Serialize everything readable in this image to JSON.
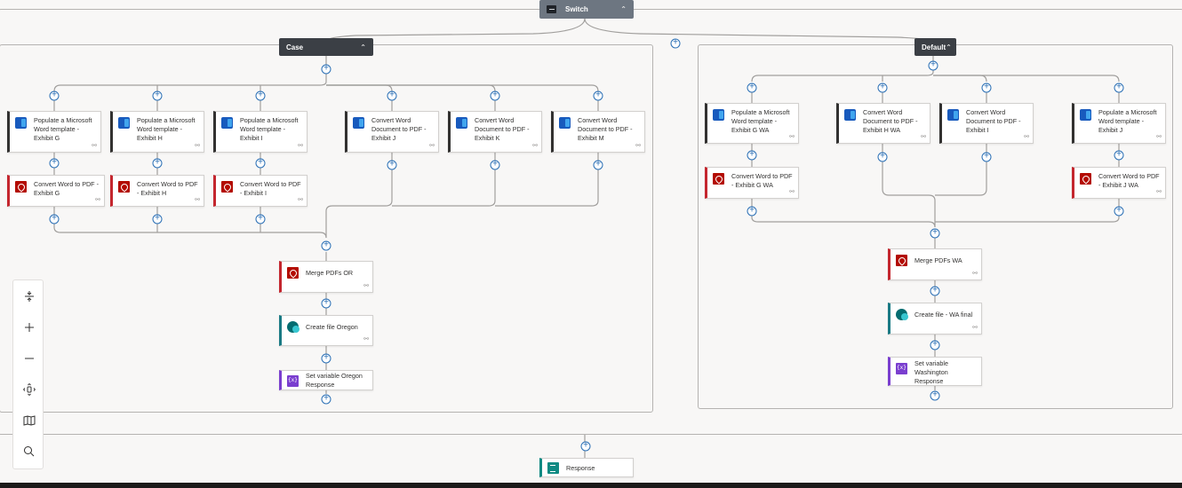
{
  "switch": {
    "title": "Switch"
  },
  "case": {
    "title": "Case",
    "branches": [
      [
        "Populate a Microsoft Word template - Exhibit G",
        "Convert Word to PDF - Exhibit G"
      ],
      [
        "Populate a Microsoft Word template - Exhibit H",
        "Convert Word to PDF - Exhibit H"
      ],
      [
        "Populate a Microsoft Word template - Exhibit I",
        "Convert Word to PDF - Exhibit I"
      ],
      [
        "Convert Word Document to PDF - Exhibit J"
      ],
      [
        "Convert Word Document to PDF - Exhibit K"
      ],
      [
        "Convert Word Document to PDF - Exhibit M"
      ]
    ],
    "merge": "Merge PDFs OR",
    "create_file": "Create file Oregon",
    "set_variable": "Set variable Oregon Response"
  },
  "default": {
    "title": "Default",
    "branches": [
      [
        "Populate a Microsoft Word template - Exhibit G WA",
        "Convert Word to PDF - Exhibit G WA"
      ],
      [
        "Convert Word Document to PDF - Exhibit H WA"
      ],
      [
        "Convert Word Document to PDF - Exhibit I"
      ],
      [
        "Populate a Microsoft Word template - Exhibit J",
        "Convert Word to PDF - Exhibit J WA"
      ]
    ],
    "merge": "Merge PDFs WA",
    "create_file": "Create file - WA final",
    "set_variable": "Set variable Washington Response"
  },
  "response": "Response",
  "toolbar": {
    "fit": "fit-to-screen-icon",
    "zoom_in": "zoom-in-icon",
    "zoom_out": "zoom-out-icon",
    "center": "center-view-icon",
    "minimap": "minimap-icon",
    "search": "search-icon"
  }
}
